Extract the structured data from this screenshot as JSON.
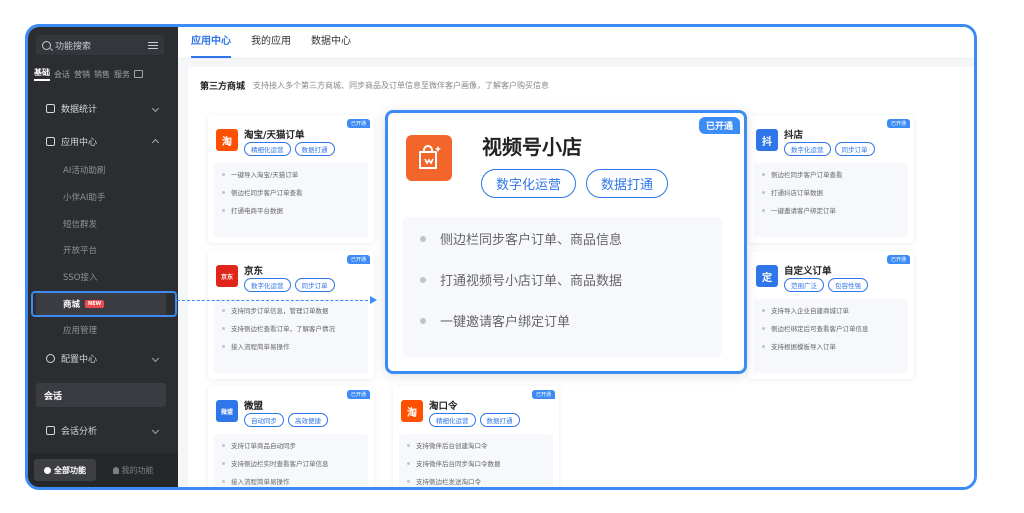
{
  "sidebar": {
    "search_label": "功能搜索",
    "categories": [
      "基础",
      "会话",
      "营销",
      "销售",
      "服务"
    ],
    "items": [
      {
        "label": "数据统计"
      },
      {
        "label": "应用中心"
      }
    ],
    "sub_items": [
      "AI活动助刷",
      "小伴AI助手",
      "短信群发",
      "开放平台",
      "SSO接入",
      "商城",
      "应用管理"
    ],
    "new_badge": "NEW",
    "config_label": "配置中心",
    "conversation_label": "会话",
    "conv_analysis_label": "会话分析",
    "all_functions": "全部功能",
    "my_functions": "我的功能"
  },
  "tabs": [
    "应用中心",
    "我的应用",
    "数据中心"
  ],
  "section": {
    "title": "第三方商城",
    "desc": "支持接入多个第三方商城、同步商品及订单信息至微伴客户画像，了解客户购买信息"
  },
  "opened_badge": "已开通",
  "cards": [
    {
      "logo": "淘",
      "title": "淘宝/天猫订单",
      "tags": [
        "精细化运营",
        "数据打通"
      ],
      "features": [
        "一键导入淘宝/天猫订单",
        "侧边栏同步客户订单查看",
        "打通电商平台数据"
      ]
    },
    {
      "logo": "京东",
      "title": "京东",
      "tags": [
        "数字化运营",
        "同步订单"
      ],
      "features": [
        "支持同步订单信息，管理订单数据",
        "支持侧边栏查看订单，了解客户情况",
        "接入流程简单易操作"
      ]
    },
    {
      "logo": "微盟",
      "title": "微盟",
      "tags": [
        "自动同步",
        "高效便捷"
      ],
      "features": [
        "支持订单商品自动同步",
        "支持侧边栏实时查看客户订单信息",
        "接入流程简单易操作"
      ]
    },
    {
      "logo": "淘",
      "title": "淘口令",
      "tags": [
        "精细化运营",
        "数据打通"
      ],
      "features": [
        "支持微伴后台创建淘口令",
        "支持微伴后台同步淘口令数据",
        "支持侧边栏发送淘口令"
      ]
    },
    {
      "logo": "抖",
      "title": "抖店",
      "tags": [
        "数字化运营",
        "同步订单"
      ],
      "features": [
        "侧边栏同步客户订单查看",
        "打通抖店订单数据",
        "一键邀请客户绑定订单"
      ]
    },
    {
      "logo": "定",
      "title": "自定义订单",
      "tags": [
        "范围广泛",
        "包容性强"
      ],
      "features": [
        "支持导入企业自建商城订单",
        "侧边栏绑定后可查看客户订单信息",
        "支持根据模板导入订单"
      ]
    }
  ],
  "featured": {
    "title": "视频号小店",
    "tags": [
      "数字化运营",
      "数据打通"
    ],
    "features": [
      "侧边栏同步客户订单、商品信息",
      "打通视频号小店订单、商品数据",
      "一键邀请客户绑定订单"
    ]
  },
  "colors": {
    "accent": "#3d8cf5",
    "taobao": "#ff5000",
    "jd": "#e1251b",
    "weimeng": "#2f76e8",
    "doudian": "#2f76e8",
    "video": "#f2662b"
  }
}
